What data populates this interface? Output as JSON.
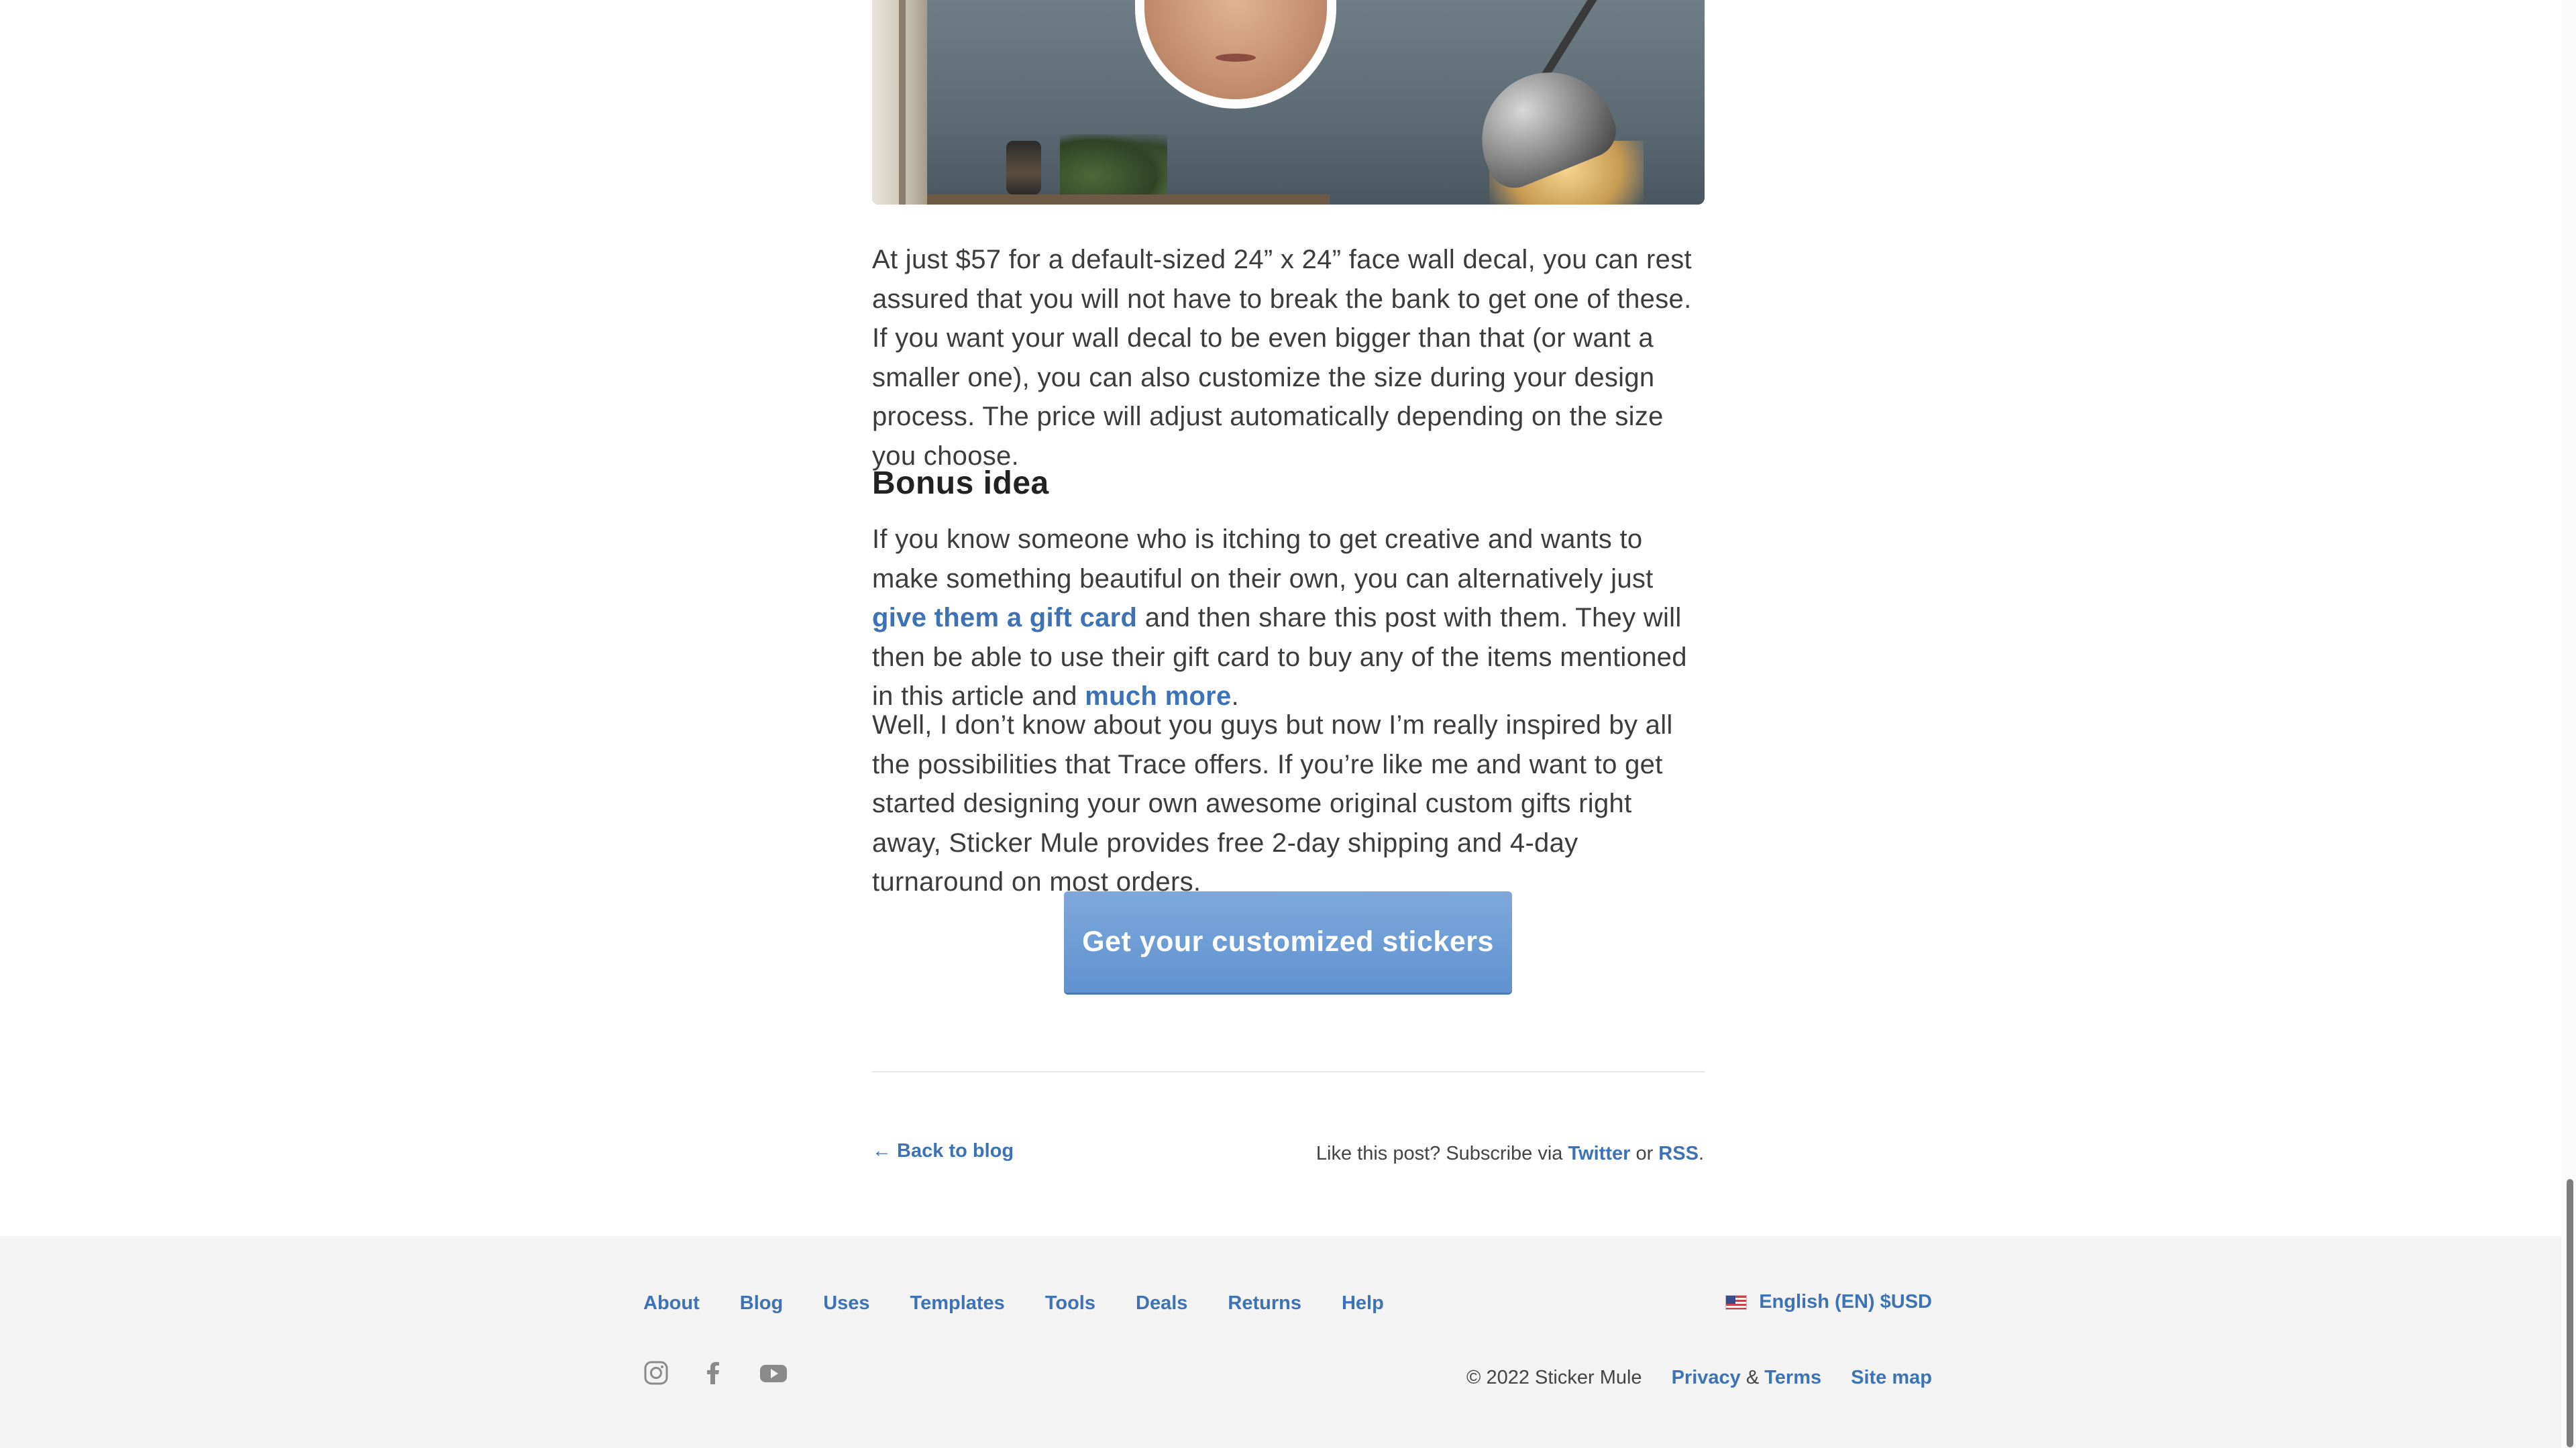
{
  "article": {
    "paragraph1": "At just $57 for a default-sized 24” x 24” face wall decal, you can rest assured that you will not have to break the bank to get one of these. If you want your wall decal to be even bigger than that (or want a smaller one), you can also customize the size during your design process. The price will adjust automatically depending on the size you choose.",
    "heading_bonus": "Bonus idea",
    "paragraph2_part1": "If you know someone who is itching to get creative and wants to make something beautiful on their own, you can alternatively just ",
    "paragraph2_link1": "give them a gift card",
    "paragraph2_part2": " and then share this post with them. They will then be able to use their gift card to buy any of the items mentioned in this article and ",
    "paragraph2_link2": "much more",
    "paragraph2_part3": ".",
    "paragraph3": "Well, I don’t know about you guys but now I’m really inspired by all the possibilities that Trace offers. If you’re like me and want to get started designing your own awesome original custom gifts right away, Sticker Mule provides free 2-day shipping and 4-day turnaround on most orders.",
    "cta_label": "Get your customized stickers"
  },
  "post_footer": {
    "back_link": "← Back to blog",
    "subscribe_text": "Like this post? Subscribe via ",
    "twitter": "Twitter",
    "or": " or ",
    "rss": "RSS",
    "period": "."
  },
  "footer": {
    "nav": [
      "About",
      "Blog",
      "Uses",
      "Templates",
      "Tools",
      "Deals",
      "Returns",
      "Help"
    ],
    "language": "English (EN) $USD",
    "copyright": "© 2022 Sticker Mule",
    "privacy": "Privacy",
    "amp": " & ",
    "terms": "Terms",
    "sitemap": "Site map",
    "social_icons": [
      "instagram-icon",
      "facebook-icon",
      "youtube-icon"
    ]
  },
  "colors": {
    "link": "#3d73b6",
    "cta_background": "#6b9ad3",
    "footer_background": "#f3f3f3"
  }
}
